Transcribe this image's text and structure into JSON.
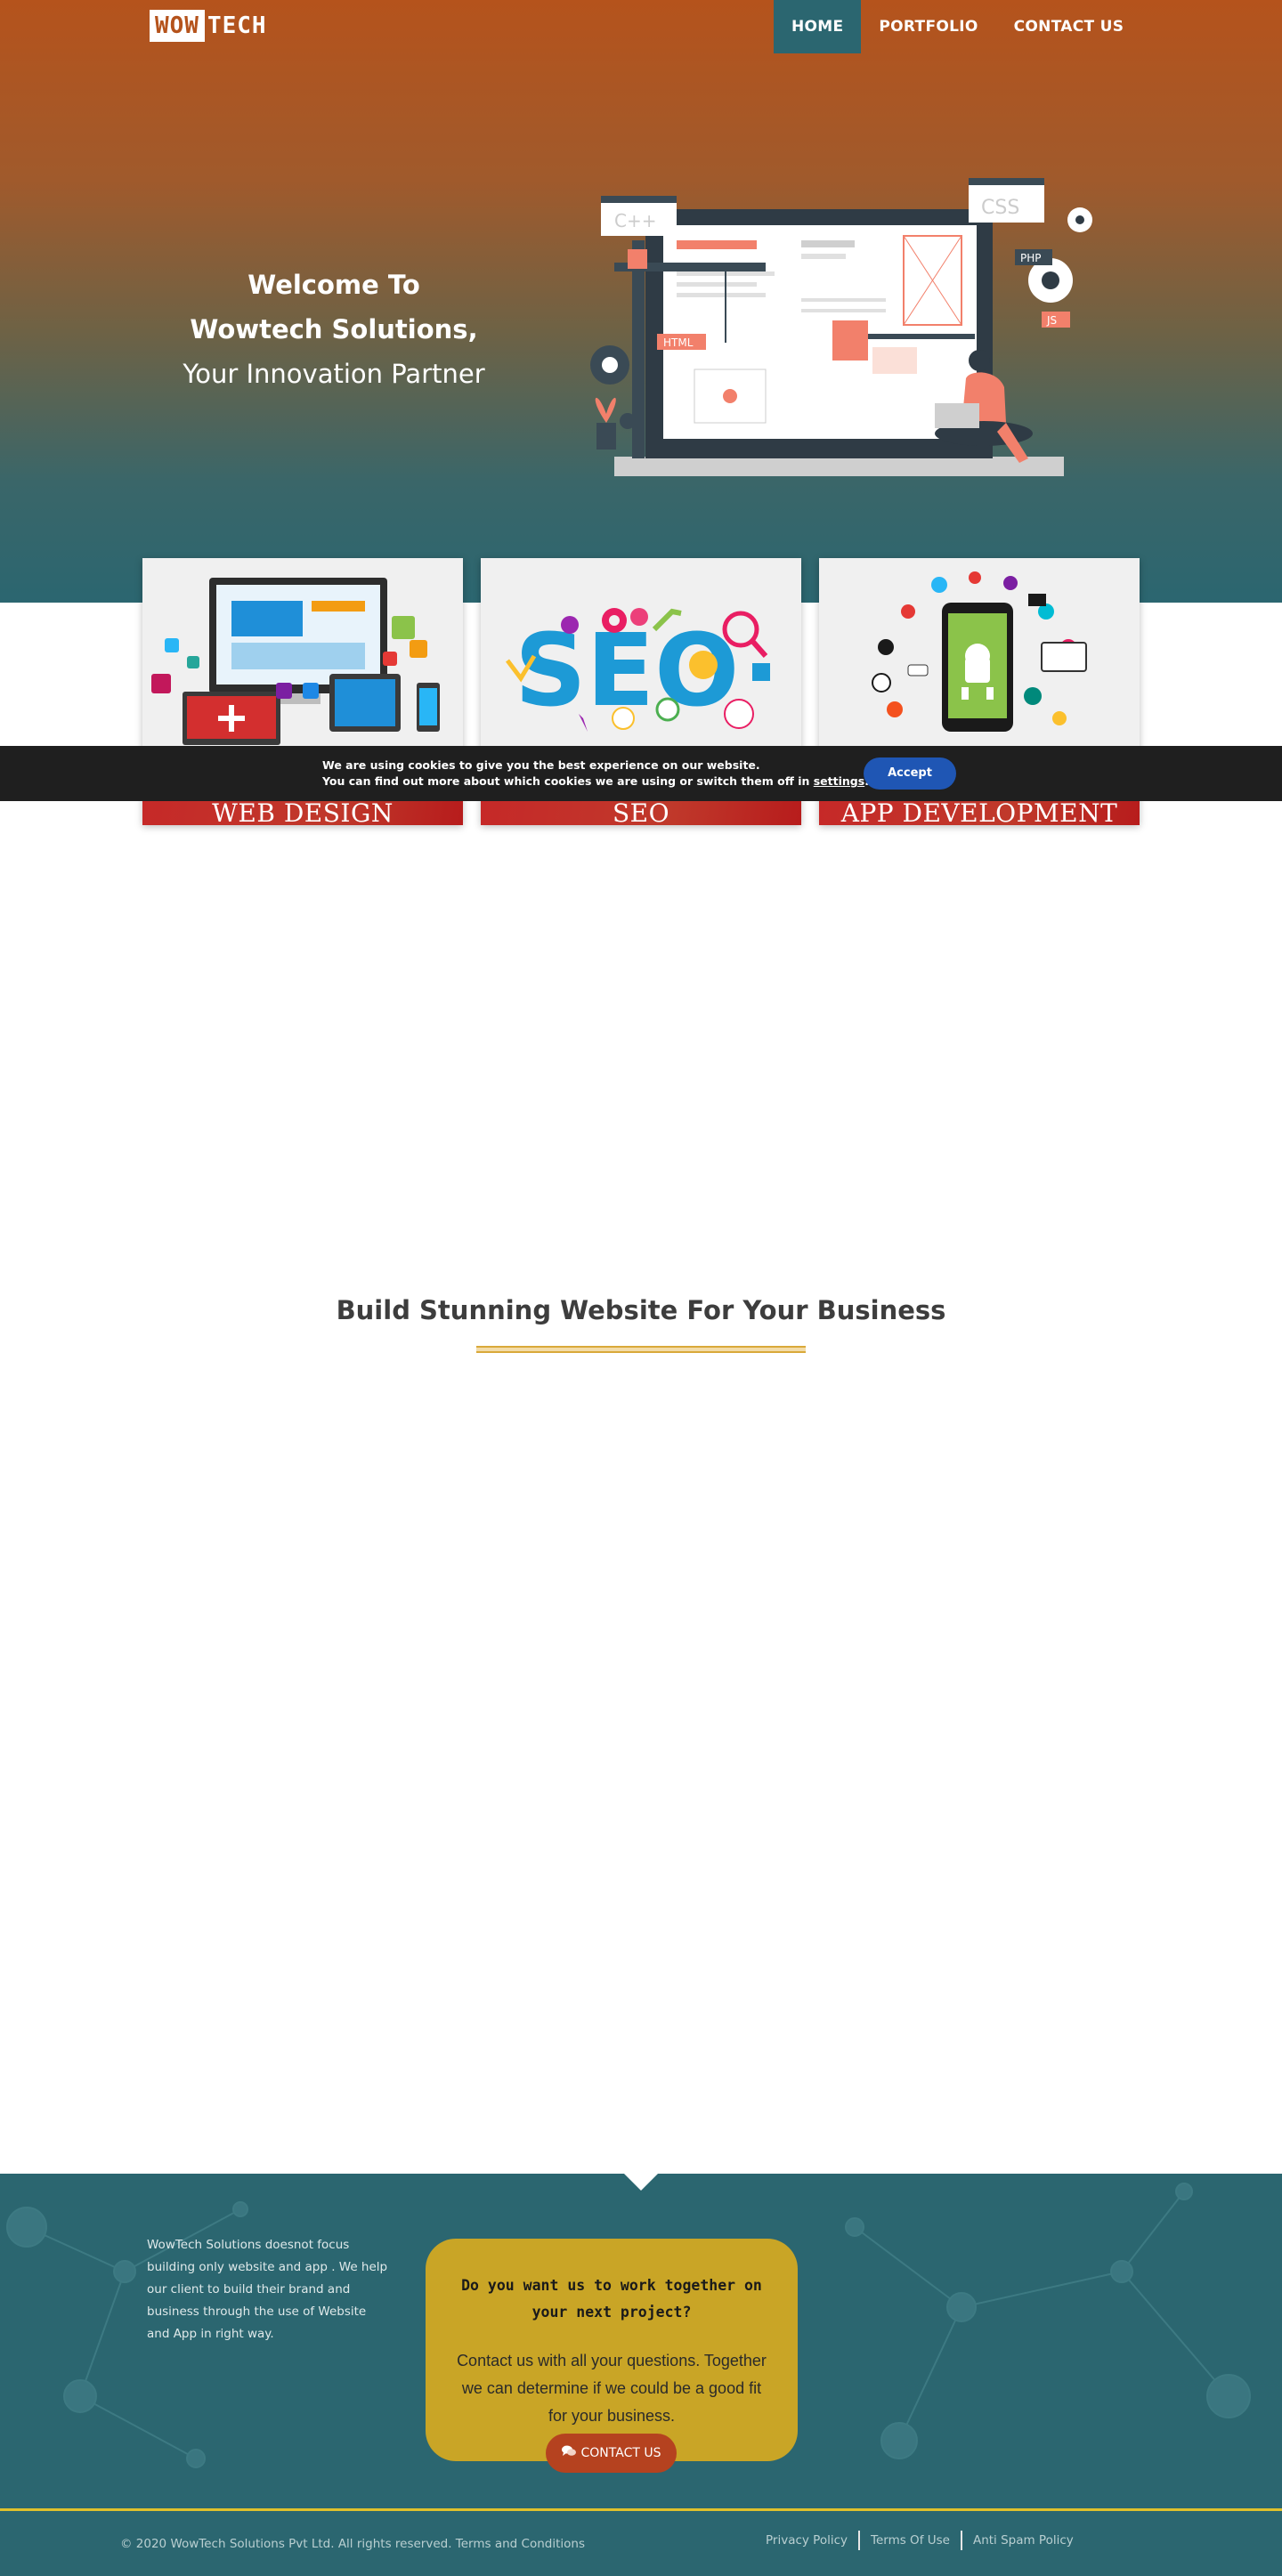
{
  "brand": {
    "logo_box": "WOW",
    "logo_rest": "TECH"
  },
  "nav": {
    "items": [
      "HOME",
      "PORTFOLIO",
      "CONTACT US"
    ],
    "active": "HOME"
  },
  "hero": {
    "line1": "Welcome To",
    "line2": "Wowtech Solutions,",
    "line3": "Your Innovation Partner",
    "illustration_tags": [
      "C++",
      "CSS",
      "PHP",
      "HTML",
      "JS"
    ]
  },
  "services": [
    {
      "title": "WEB DESIGN"
    },
    {
      "title": "SEO"
    },
    {
      "title": "APP DEVELOPMENT"
    }
  ],
  "cookie": {
    "line1": "We are using cookies to give you the best experience on our website.",
    "line2_prefix": "You can find out more about which cookies we are using or switch them off in ",
    "line2_link": "settings",
    "line2_suffix": ".",
    "accept_label": "Accept"
  },
  "section": {
    "title": "Build Stunning Website For Your Business"
  },
  "footer": {
    "about": "WowTech Solutions doesnot focus building only website and app . We help our client to build their brand and business through the use of Website and App in right way.",
    "callout_question": "Do you want us to work together on your next project?",
    "callout_text": "Contact us with all your questions. Together we can determine if we could be a good fit for your business.",
    "contact_label": "CONTACT US",
    "contact_icon": "chat-bubbles-icon",
    "copyright": "© 2020 WowTech Solutions Pvt Ltd. All rights reserved. Terms and Conditions",
    "links": [
      "Privacy Policy",
      "Terms Of Use",
      "Anti Spam Policy"
    ]
  },
  "colors": {
    "brand_orange": "#b5531c",
    "teal": "#2b6670",
    "card_red": "#c62828",
    "accept_blue": "#1f56b4",
    "callout_gold": "#c9a526",
    "contact_red": "#b5421f"
  }
}
